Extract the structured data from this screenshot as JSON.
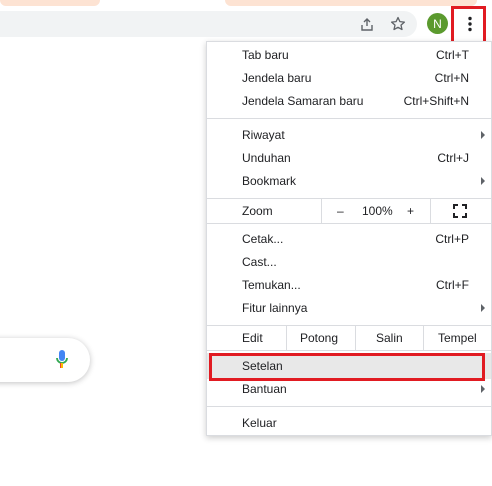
{
  "colors": {
    "highlight": "#e11b22",
    "avatar": "#5b9a2e",
    "menu_hover": "#e8e8e8"
  },
  "toolbar": {
    "share_icon": "share-icon",
    "bookmark_icon": "star-icon",
    "avatar_initial": "N",
    "menu_icon": "three-dots-vertical-icon"
  },
  "menu": {
    "new_tab": {
      "label": "Tab baru",
      "shortcut": "Ctrl+T"
    },
    "new_window": {
      "label": "Jendela baru",
      "shortcut": "Ctrl+N"
    },
    "incognito": {
      "label": "Jendela Samaran baru",
      "shortcut": "Ctrl+Shift+N"
    },
    "history": {
      "label": "Riwayat"
    },
    "downloads": {
      "label": "Unduhan",
      "shortcut": "Ctrl+J"
    },
    "bookmarks": {
      "label": "Bookmark"
    },
    "zoom": {
      "label": "Zoom",
      "minus": "–",
      "level": "100%",
      "plus": "+"
    },
    "print": {
      "label": "Cetak...",
      "shortcut": "Ctrl+P"
    },
    "cast": {
      "label": "Cast..."
    },
    "find": {
      "label": "Temukan...",
      "shortcut": "Ctrl+F"
    },
    "more_tools": {
      "label": "Fitur lainnya"
    },
    "edit": {
      "label": "Edit",
      "cut": "Potong",
      "copy": "Salin",
      "paste": "Tempel"
    },
    "settings": {
      "label": "Setelan"
    },
    "help": {
      "label": "Bantuan"
    },
    "exit": {
      "label": "Keluar"
    }
  }
}
